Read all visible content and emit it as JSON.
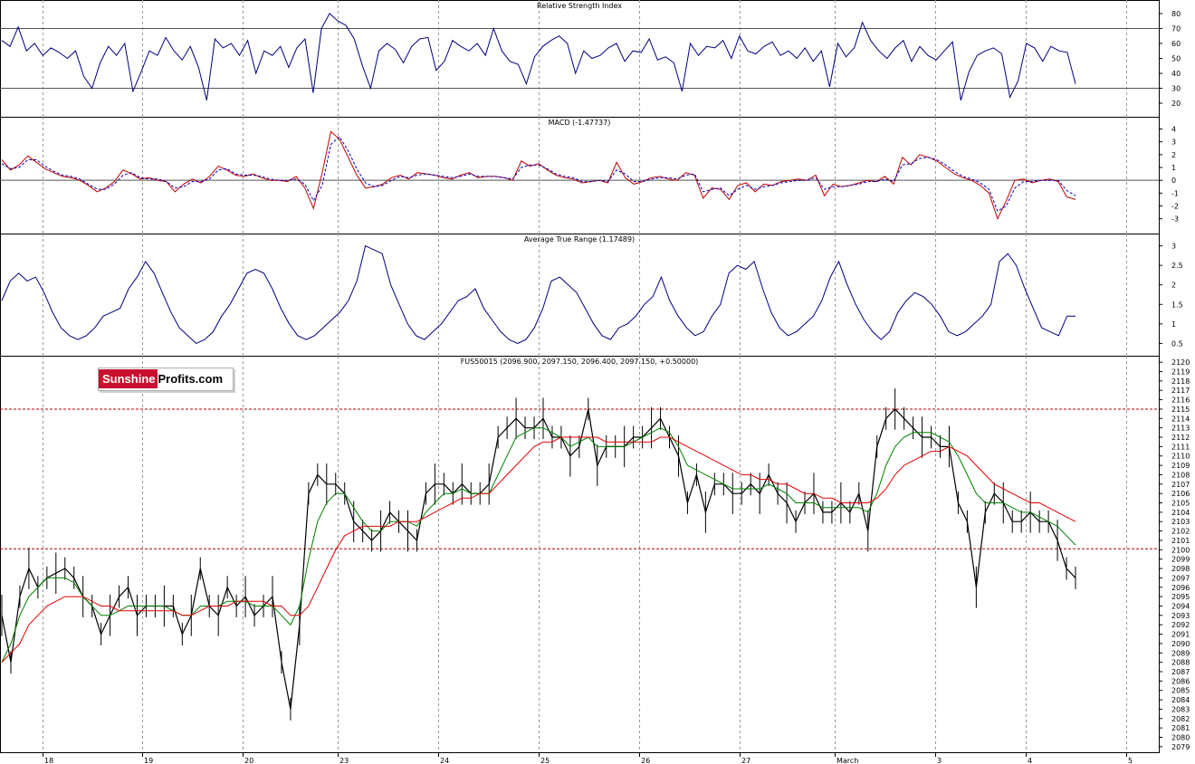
{
  "logo": {
    "part1": "Sunshine",
    "part2": "Profits.com"
  },
  "chart_data": [
    {
      "type": "line",
      "title": "Relative Strength Index",
      "ylim": [
        14,
        86
      ],
      "y_ticks": [
        20,
        30,
        40,
        50,
        60,
        70,
        80
      ],
      "reference_lines": [
        30,
        70
      ],
      "color": "#000080",
      "series": [
        {
          "values": [
            62,
            58,
            71,
            55,
            60,
            52,
            57,
            54,
            50,
            55,
            38,
            30,
            47,
            58,
            52,
            60,
            28,
            41,
            55,
            52,
            64,
            55,
            49,
            58,
            44,
            22,
            63,
            57,
            60,
            52,
            62,
            40,
            55,
            52,
            58,
            44,
            57,
            63,
            27,
            70,
            80,
            75,
            72,
            63,
            45,
            30,
            55,
            60,
            56,
            47,
            58,
            63,
            64,
            42,
            48,
            62,
            58,
            55,
            60,
            52,
            70,
            55,
            48,
            46,
            33,
            51,
            58,
            62,
            65,
            60,
            40,
            55,
            50,
            52,
            57,
            60,
            48,
            55,
            54,
            63,
            49,
            51,
            47,
            28,
            60,
            52,
            58,
            57,
            62,
            50,
            65,
            55,
            53,
            58,
            61,
            52,
            55,
            50,
            57,
            48,
            55,
            31,
            60,
            51,
            57,
            74,
            62,
            55,
            50,
            57,
            62,
            48,
            58,
            52,
            49,
            55,
            61,
            22,
            41,
            52,
            55,
            57,
            53,
            24,
            35,
            60,
            57,
            48,
            58,
            55,
            54,
            33
          ]
        }
      ]
    },
    {
      "type": "line",
      "title": "MACD (-1.47737)",
      "ylim": [
        -3.8,
        4.6
      ],
      "y_ticks": [
        -3,
        -2,
        -1,
        0,
        1,
        2,
        3,
        4
      ],
      "series": [
        {
          "color": "#c00000",
          "values": [
            1.6,
            0.8,
            1.2,
            1.9,
            1.4,
            0.9,
            0.6,
            0.3,
            0.2,
            0.0,
            -0.4,
            -0.9,
            -0.6,
            -0.1,
            0.8,
            0.5,
            0.1,
            0.2,
            0.0,
            -0.1,
            -0.9,
            -0.3,
            0.1,
            -0.2,
            0.3,
            1.1,
            0.8,
            0.4,
            0.3,
            0.5,
            0.2,
            0.0,
            0.0,
            -0.1,
            0.3,
            -0.6,
            -2.2,
            0.6,
            3.8,
            3.2,
            1.8,
            0.4,
            -0.6,
            -0.5,
            -0.3,
            0.2,
            0.4,
            0.1,
            0.6,
            0.5,
            0.4,
            0.2,
            0.1,
            0.4,
            0.6,
            0.2,
            0.3,
            0.3,
            0.2,
            0.0,
            1.5,
            1.1,
            1.3,
            0.8,
            0.4,
            0.2,
            0.1,
            -0.2,
            -0.1,
            0.0,
            -0.2,
            1.4,
            0.2,
            -0.3,
            -0.1,
            0.2,
            0.3,
            0.1,
            0.0,
            0.6,
            0.4,
            -1.4,
            -0.6,
            -0.7,
            -1.5,
            -0.4,
            -0.2,
            -0.9,
            -0.3,
            -0.4,
            -0.1,
            0.0,
            0.1,
            0.0,
            0.4,
            -1.2,
            -0.3,
            -0.5,
            -0.4,
            -0.2,
            0.0,
            -0.1,
            0.3,
            -0.3,
            1.8,
            1.2,
            2.0,
            1.8,
            1.5,
            1.0,
            0.5,
            0.2,
            0.0,
            -0.4,
            -1.0,
            -3.0,
            -1.6,
            0.0,
            0.1,
            -0.2,
            0.0,
            0.1,
            -0.1,
            -1.3,
            -1.5
          ]
        },
        {
          "color": "#0000c0",
          "dashed": true,
          "values": [
            1.3,
            0.9,
            1.0,
            1.6,
            1.6,
            1.1,
            0.7,
            0.4,
            0.3,
            0.1,
            -0.3,
            -0.7,
            -0.7,
            -0.3,
            0.4,
            0.6,
            0.2,
            0.1,
            0.1,
            -0.1,
            -0.6,
            -0.5,
            -0.1,
            -0.1,
            0.1,
            0.8,
            0.9,
            0.5,
            0.4,
            0.4,
            0.3,
            0.1,
            0.0,
            0.0,
            0.1,
            -0.3,
            -1.6,
            -0.4,
            2.8,
            3.4,
            2.3,
            0.9,
            -0.2,
            -0.5,
            -0.4,
            0.0,
            0.3,
            0.2,
            0.4,
            0.5,
            0.4,
            0.3,
            0.2,
            0.3,
            0.5,
            0.3,
            0.3,
            0.3,
            0.2,
            0.1,
            1.0,
            1.2,
            1.2,
            0.9,
            0.5,
            0.3,
            0.2,
            -0.1,
            -0.1,
            0.0,
            -0.1,
            0.8,
            0.5,
            -0.1,
            -0.1,
            0.1,
            0.2,
            0.2,
            0.1,
            0.4,
            0.5,
            -0.9,
            -0.7,
            -0.6,
            -1.2,
            -0.7,
            -0.4,
            -0.7,
            -0.5,
            -0.4,
            -0.2,
            -0.1,
            0.0,
            0.0,
            0.2,
            -0.7,
            -0.5,
            -0.5,
            -0.4,
            -0.3,
            -0.1,
            -0.1,
            0.1,
            -0.1,
            1.2,
            1.3,
            1.7,
            1.8,
            1.6,
            1.2,
            0.7,
            0.3,
            0.1,
            -0.2,
            -0.7,
            -2.4,
            -2.0,
            -0.6,
            -0.1,
            -0.1,
            0.0,
            0.0,
            0.0,
            -0.8,
            -1.2
          ]
        }
      ]
    },
    {
      "type": "line",
      "title": "Average True Range (1.17489)",
      "ylim": [
        0.3,
        3.2
      ],
      "y_ticks": [
        0.5,
        1.0,
        1.5,
        2.0,
        2.5,
        3.0
      ],
      "color": "#000080",
      "series": [
        {
          "values": [
            1.6,
            2.1,
            2.3,
            2.1,
            2.2,
            1.8,
            1.3,
            0.9,
            0.7,
            0.6,
            0.7,
            0.9,
            1.2,
            1.3,
            1.4,
            1.9,
            2.2,
            2.6,
            2.3,
            1.8,
            1.3,
            0.9,
            0.7,
            0.5,
            0.6,
            0.8,
            1.2,
            1.5,
            1.9,
            2.3,
            2.4,
            2.3,
            1.9,
            1.4,
            1.0,
            0.7,
            0.6,
            0.7,
            0.9,
            1.1,
            1.3,
            1.6,
            2.1,
            3.0,
            2.9,
            2.8,
            2.0,
            1.5,
            1.0,
            0.7,
            0.6,
            0.8,
            1.0,
            1.3,
            1.6,
            1.7,
            1.9,
            1.4,
            1.1,
            0.8,
            0.6,
            0.5,
            0.6,
            0.9,
            1.4,
            2.1,
            2.2,
            2.0,
            1.8,
            1.4,
            1.0,
            0.7,
            0.6,
            0.9,
            1.0,
            1.2,
            1.5,
            1.7,
            2.2,
            1.6,
            1.2,
            0.9,
            0.7,
            0.8,
            1.2,
            1.5,
            2.3,
            2.5,
            2.4,
            2.6,
            1.9,
            1.3,
            0.9,
            0.7,
            0.8,
            1.0,
            1.2,
            1.6,
            2.2,
            2.6,
            2.0,
            1.5,
            1.1,
            0.8,
            0.6,
            0.8,
            1.3,
            1.6,
            1.8,
            1.7,
            1.5,
            1.2,
            0.8,
            0.7,
            0.8,
            1.0,
            1.2,
            1.5,
            2.6,
            2.8,
            2.5,
            1.9,
            1.4,
            0.9,
            0.8,
            0.7,
            1.2,
            1.2
          ]
        }
      ]
    },
    {
      "type": "line",
      "title": "FUS50015 (2096.900, 2097.150, 2096.400, 2097.150, +0.50000)",
      "ylim": [
        2078.6,
        2120.4
      ],
      "y_ticks": [
        2079,
        2080,
        2081,
        2082,
        2083,
        2084,
        2085,
        2086,
        2087,
        2088,
        2089,
        2090,
        2091,
        2092,
        2093,
        2094,
        2095,
        2096,
        2097,
        2098,
        2099,
        2100,
        2101,
        2102,
        2103,
        2104,
        2105,
        2106,
        2107,
        2108,
        2109,
        2110,
        2111,
        2112,
        2113,
        2114,
        2115,
        2116,
        2117,
        2118,
        2119,
        2120
      ],
      "reference_lines": [
        2115,
        2100.1
      ],
      "x_labels": [
        "18",
        "19",
        "20",
        "23",
        "24",
        "25",
        "26",
        "27",
        "March",
        "3",
        "4",
        "5"
      ],
      "series": [
        {
          "color": "#000000",
          "values": [
            2093,
            2088,
            2095,
            2098,
            2096,
            2097,
            2097.5,
            2098,
            2097,
            2095,
            2094,
            2091,
            2093,
            2095,
            2096,
            2093,
            2094,
            2094,
            2094,
            2094,
            2091,
            2093,
            2098,
            2094,
            2093,
            2096,
            2094,
            2095,
            2093,
            2094,
            2095,
            2088,
            2083,
            2092,
            2106,
            2108,
            2107,
            2107,
            2106,
            2103,
            2102,
            2101,
            2102,
            2104,
            2103,
            2102,
            2101,
            2106,
            2107,
            2107,
            2106,
            2107,
            2106,
            2106,
            2107,
            2112,
            2113,
            2114,
            2113,
            2113,
            2114,
            2112,
            2112,
            2110,
            2111,
            2115,
            2109,
            2111,
            2111,
            2111,
            2112,
            2112,
            2113,
            2114,
            2112,
            2110,
            2105,
            2108,
            2104,
            2107,
            2107,
            2106,
            2106,
            2107,
            2106,
            2108,
            2106,
            2105,
            2103,
            2105,
            2106,
            2104,
            2104,
            2105,
            2104,
            2106,
            2102,
            2111,
            2114,
            2115,
            2114,
            2113,
            2112,
            2112,
            2111,
            2111,
            2105,
            2103,
            2096,
            2104,
            2106,
            2105,
            2103,
            2103,
            2104,
            2103,
            2103,
            2101,
            2098,
            2097
          ]
        },
        {
          "color": "#008000",
          "values": [
            2088,
            2090,
            2093,
            2095,
            2096,
            2097,
            2097,
            2097,
            2096.5,
            2095,
            2094,
            2093,
            2093,
            2093.5,
            2094,
            2094,
            2094,
            2094,
            2094,
            2093.5,
            2093,
            2093,
            2094,
            2094,
            2094,
            2094.5,
            2094.5,
            2094.5,
            2094,
            2094,
            2094,
            2093,
            2092,
            2094,
            2099,
            2103,
            2105,
            2106,
            2106,
            2104.5,
            2103,
            2102,
            2102,
            2103,
            2103,
            2103,
            2102.5,
            2104,
            2105,
            2106,
            2106,
            2106.5,
            2106,
            2106,
            2106,
            2108,
            2110,
            2112,
            2112.5,
            2113,
            2113,
            2112.5,
            2112,
            2111,
            2111.5,
            2112,
            2111,
            2111,
            2111,
            2111,
            2111.5,
            2112,
            2112.5,
            2113,
            2112.5,
            2111,
            2109,
            2108.5,
            2108,
            2107.5,
            2107,
            2106.5,
            2106.5,
            2106.5,
            2106.5,
            2107,
            2106.5,
            2106,
            2105,
            2105,
            2105,
            2104.5,
            2104.5,
            2104.5,
            2104.5,
            2104.5,
            2104,
            2106,
            2109,
            2111,
            2112,
            2112.5,
            2112.5,
            2112.5,
            2112,
            2111.5,
            2110,
            2108,
            2106,
            2105,
            2105,
            2105,
            2104.5,
            2104,
            2104,
            2103.5,
            2103,
            2102.5,
            2101.5,
            2100.5
          ]
        },
        {
          "color": "#e00000",
          "values": [
            2088,
            2089,
            2090,
            2092,
            2093,
            2094,
            2094.5,
            2095,
            2095,
            2095,
            2094.5,
            2094,
            2094,
            2093.5,
            2093.5,
            2093.5,
            2093.5,
            2093.5,
            2093.5,
            2093.5,
            2093,
            2093,
            2093.5,
            2094,
            2094,
            2094,
            2094.5,
            2094.5,
            2094.5,
            2094.5,
            2094,
            2094,
            2093,
            2093,
            2094,
            2096,
            2098,
            2100,
            2101.5,
            2102,
            2102.5,
            2102.5,
            2102.5,
            2102.5,
            2103,
            2103,
            2103,
            2103.5,
            2104,
            2104.5,
            2105,
            2105.5,
            2105.5,
            2106,
            2106,
            2107,
            2108,
            2109,
            2110,
            2111,
            2111.5,
            2111.5,
            2112,
            2112,
            2112,
            2112,
            2112,
            2111.5,
            2111.5,
            2111.5,
            2111.5,
            2111.5,
            2111.5,
            2112,
            2112,
            2111.5,
            2111,
            2110.5,
            2110,
            2109.5,
            2109,
            2108.5,
            2108,
            2108,
            2107.5,
            2107.5,
            2107,
            2107,
            2106.5,
            2106,
            2106,
            2105.5,
            2105.5,
            2105,
            2105,
            2105,
            2105,
            2105.5,
            2106.5,
            2108,
            2109,
            2109.5,
            2110,
            2110.5,
            2110.5,
            2111,
            2110.5,
            2110,
            2109,
            2108,
            2107,
            2106.5,
            2106,
            2105.5,
            2105,
            2105,
            2104.5,
            2104,
            2103.5,
            2103
          ]
        }
      ]
    }
  ]
}
